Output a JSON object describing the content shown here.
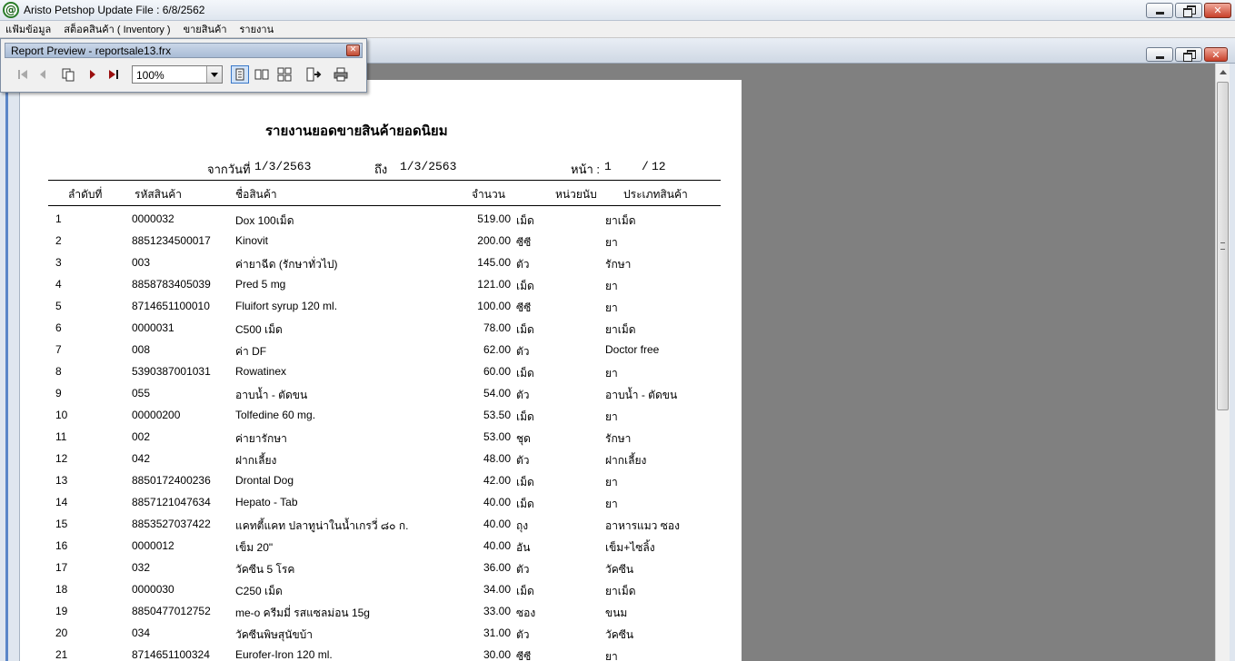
{
  "app": {
    "title": "Aristo Petshop  Update File : 6/8/2562",
    "icon_letter": "@"
  },
  "menu": {
    "items": [
      "แฟ้มข้อมูล",
      "สต็อคสินค้า ( Inventory )",
      "ขายสินค้า",
      "รายงาน"
    ]
  },
  "preview": {
    "title": "Report Preview - reportsale13.frx",
    "zoom": "100%",
    "icons": [
      "first-page-icon",
      "prev-page-icon",
      "goto-page-icon",
      "next-page-icon",
      "last-page-icon",
      "one-page-icon",
      "two-page-icon",
      "multi-page-icon",
      "close-preview-icon",
      "print-icon"
    ]
  },
  "report": {
    "title": "รายงานยอดขายสินค้ายอดนิยม",
    "from_label": "จากวันที่",
    "from_date": "1/3/2563",
    "to_label": "ถึง",
    "to_date": "1/3/2563",
    "page_label": "หน้า :",
    "page_current": "1",
    "page_sep": "/",
    "page_total": "12",
    "columns": [
      "ลำดับที่",
      "รหัสสินค้า",
      "ชื่อสินค้า",
      "จำนวน",
      "หน่วยนับ",
      "ประเภทสินค้า"
    ],
    "rows": [
      {
        "no": "1",
        "code": "0000032",
        "name": "Dox 100เม็ด",
        "qty": "519.00",
        "unit": "เม็ด",
        "type": "ยาเม็ด"
      },
      {
        "no": "2",
        "code": "8851234500017",
        "name": "Kinovit",
        "qty": "200.00",
        "unit": "ซีซี",
        "type": "ยา"
      },
      {
        "no": "3",
        "code": "003",
        "name": "ค่ายาฉีด (รักษาทั่วไป)",
        "qty": "145.00",
        "unit": "ตัว",
        "type": "รักษา"
      },
      {
        "no": "4",
        "code": "8858783405039",
        "name": "Pred 5 mg",
        "qty": "121.00",
        "unit": "เม็ด",
        "type": "ยา"
      },
      {
        "no": "5",
        "code": "8714651100010",
        "name": "Fluifort syrup 120 ml.",
        "qty": "100.00",
        "unit": "ซีซี",
        "type": "ยา"
      },
      {
        "no": "6",
        "code": "0000031",
        "name": "C500 เม็ด",
        "qty": "78.00",
        "unit": "เม็ด",
        "type": "ยาเม็ด"
      },
      {
        "no": "7",
        "code": "008",
        "name": "ค่า DF",
        "qty": "62.00",
        "unit": "ตัว",
        "type": "Doctor free"
      },
      {
        "no": "8",
        "code": "5390387001031",
        "name": "Rowatinex",
        "qty": "60.00",
        "unit": "เม็ด",
        "type": "ยา"
      },
      {
        "no": "9",
        "code": "055",
        "name": "อาบน้ำ - ตัดขน",
        "qty": "54.00",
        "unit": "ตัว",
        "type": "อาบน้ำ - ตัดขน"
      },
      {
        "no": "10",
        "code": "00000200",
        "name": "Tolfedine 60 mg.",
        "qty": "53.50",
        "unit": "เม็ด",
        "type": "ยา"
      },
      {
        "no": "11",
        "code": "002",
        "name": "ค่ายารักษา",
        "qty": "53.00",
        "unit": "ชุด",
        "type": "รักษา"
      },
      {
        "no": "12",
        "code": "042",
        "name": "ฝากเลี้ยง",
        "qty": "48.00",
        "unit": "ตัว",
        "type": "ฝากเลี้ยง"
      },
      {
        "no": "13",
        "code": "8850172400236",
        "name": "Drontal Dog",
        "qty": "42.00",
        "unit": "เม็ด",
        "type": "ยา"
      },
      {
        "no": "14",
        "code": "8857121047634",
        "name": "Hepato - Tab",
        "qty": "40.00",
        "unit": "เม็ด",
        "type": "ยา"
      },
      {
        "no": "15",
        "code": "8853527037422",
        "name": "แคทตี้แคท ปลาทูน่าในน้ำเกรวี่ ๘๐ ก.",
        "qty": "40.00",
        "unit": "ถุง",
        "type": "อาหารแมว ซอง"
      },
      {
        "no": "16",
        "code": "0000012",
        "name": "เข็ม 20\"",
        "qty": "40.00",
        "unit": "อัน",
        "type": "เข็ม+ไซลิ้ง"
      },
      {
        "no": "17",
        "code": "032",
        "name": "วัคซีน 5 โรค",
        "qty": "36.00",
        "unit": "ตัว",
        "type": "วัคซีน"
      },
      {
        "no": "18",
        "code": "0000030",
        "name": "C250 เม็ด",
        "qty": "34.00",
        "unit": "เม็ด",
        "type": "ยาเม็ด"
      },
      {
        "no": "19",
        "code": "8850477012752",
        "name": "me-o ครีมมี่ รสแซลม่อน 15g",
        "qty": "33.00",
        "unit": "ซอง",
        "type": "ขนม"
      },
      {
        "no": "20",
        "code": "034",
        "name": "วัคซีนพิษสุนัขบ้า",
        "qty": "31.00",
        "unit": "ตัว",
        "type": "วัคซีน"
      },
      {
        "no": "21",
        "code": "8714651100324",
        "name": "Eurofer-Iron 120 ml.",
        "qty": "30.00",
        "unit": "ซีซี",
        "type": "ยา"
      }
    ]
  }
}
